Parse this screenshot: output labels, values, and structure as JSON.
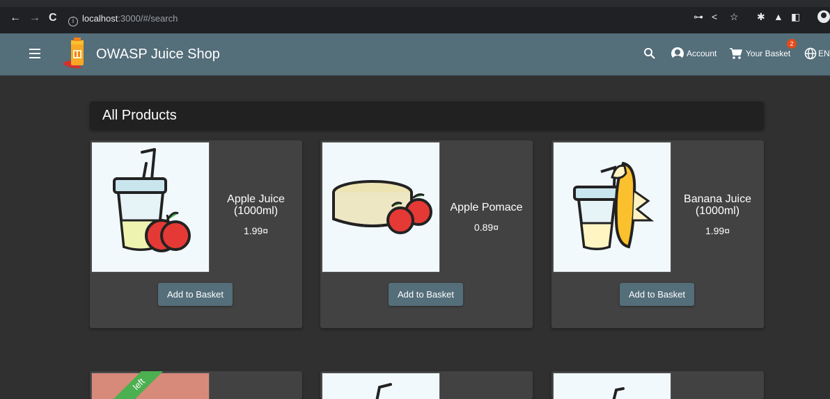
{
  "browser": {
    "url_host": "localhost",
    "url_path": ":3000/#/search"
  },
  "app": {
    "title": "OWASP Juice Shop",
    "account_label": "Account",
    "basket_label": "Your Basket",
    "basket_count": "2",
    "language_label": "EN"
  },
  "page": {
    "heading": "All Products"
  },
  "products": [
    {
      "name": "Apple Juice (1000ml)",
      "price": "1.99¤",
      "button": "Add to Basket"
    },
    {
      "name": "Apple Pomace",
      "price": "0.89¤",
      "button": "Add to Basket"
    },
    {
      "name": "Banana Juice (1000ml)",
      "price": "1.99¤",
      "button": "Add to Basket"
    }
  ],
  "second_row": {
    "ribbon": "left"
  },
  "colors": {
    "appbar": "#546e7a",
    "background": "#303030",
    "card": "#424242",
    "badge": "#e64a19",
    "ribbon": "#4caf50"
  }
}
